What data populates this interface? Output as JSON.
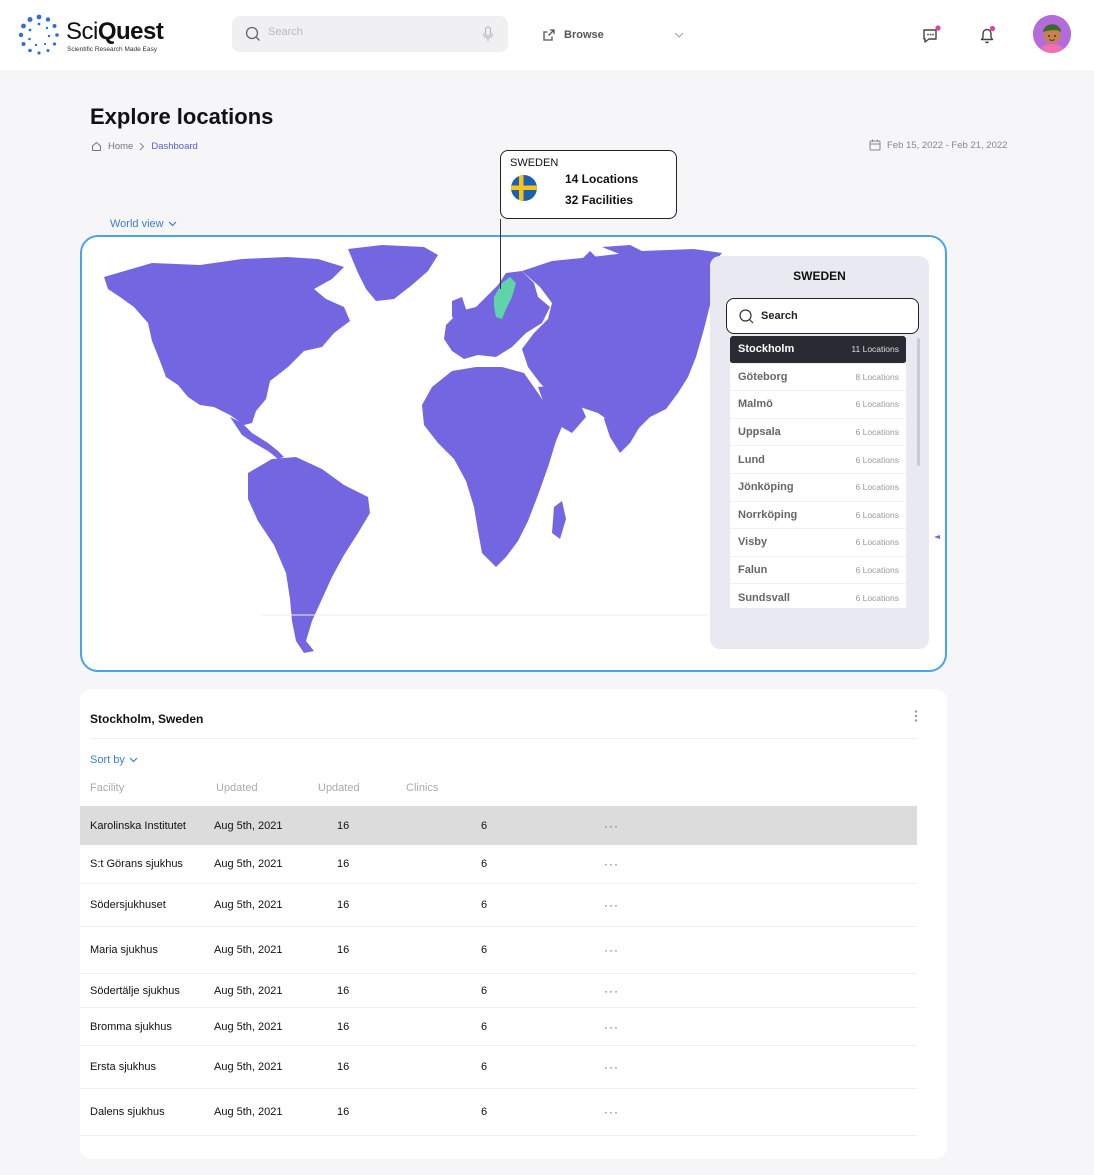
{
  "header": {
    "brand_part1": "Sci",
    "brand_part2": "Quest",
    "tagline": "Scientific Research Made Easy",
    "search_placeholder": "Search",
    "browse_label": "Browse",
    "accent_color": "#7366e0"
  },
  "page": {
    "title": "Explore locations",
    "breadcrumb": [
      "Home",
      "Dashboard"
    ],
    "date_range": "Feb 15, 2022 - Feb 21, 2022",
    "world_view_label": "World view"
  },
  "tooltip": {
    "country": "SWEDEN",
    "locations": "14 Locations",
    "facilities": "32 Facilities"
  },
  "panel": {
    "title": "SWEDEN",
    "search_label": "Search",
    "items": [
      {
        "name": "Stockholm",
        "count": "11 Locations"
      },
      {
        "name": "Göteborg",
        "count": "8 Locations"
      },
      {
        "name": "Malmö",
        "count": "6 Locations"
      },
      {
        "name": "Uppsala",
        "count": "6 Locations"
      },
      {
        "name": "Lund",
        "count": "6 Locations"
      },
      {
        "name": "Jönköping",
        "count": "6 Locations"
      },
      {
        "name": "Norrköping",
        "count": "6 Locations"
      },
      {
        "name": "Visby",
        "count": "6 Locations"
      },
      {
        "name": "Falun",
        "count": "6 Locations"
      },
      {
        "name": "Sundsvall",
        "count": "6 Locations"
      }
    ]
  },
  "table": {
    "title": "Stockholm, Sweden",
    "sort_label": "Sort by",
    "columns": [
      "Facility",
      "Updated",
      "Updated",
      "Clinics"
    ],
    "rows": [
      {
        "facility": "Karolinska Institutet",
        "updated": "Aug 5th, 2021",
        "count1": "16",
        "clinics": "6"
      },
      {
        "facility": "S:t Görans sjukhus",
        "updated": "Aug 5th, 2021",
        "count1": "16",
        "clinics": "6"
      },
      {
        "facility": "Södersjukhuset",
        "updated": "Aug 5th, 2021",
        "count1": "16",
        "clinics": "6"
      },
      {
        "facility": "Maria sjukhus",
        "updated": "Aug 5th, 2021",
        "count1": "16",
        "clinics": "6"
      },
      {
        "facility": "Södertälje sjukhus",
        "updated": "Aug 5th, 2021",
        "count1": "16",
        "clinics": "6"
      },
      {
        "facility": "Bromma sjukhus",
        "updated": "Aug 5th, 2021",
        "count1": "16",
        "clinics": "6"
      },
      {
        "facility": "Ersta sjukhus",
        "updated": "Aug 5th, 2021",
        "count1": "16",
        "clinics": "6"
      },
      {
        "facility": "Dalens sjukhus",
        "updated": "Aug 5th, 2021",
        "count1": "16",
        "clinics": "6"
      }
    ],
    "row_action": "···"
  }
}
